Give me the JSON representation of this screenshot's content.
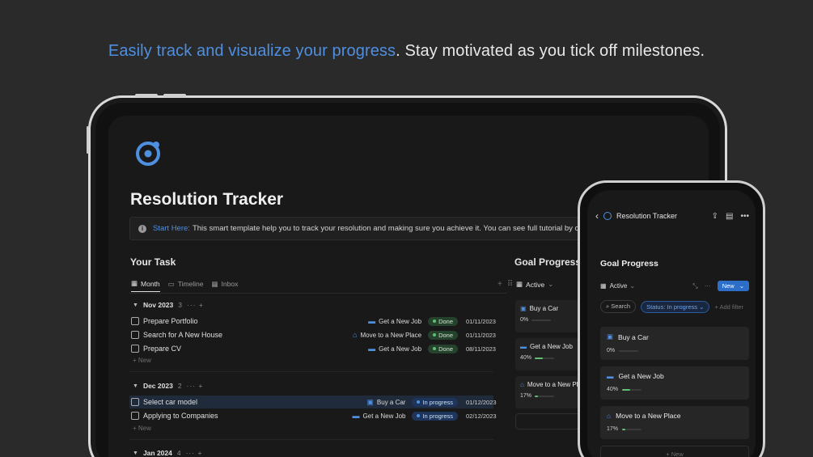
{
  "headline": {
    "accent": "Easily track and visualize your progress",
    "rest": ". Stay motivated as you tick off milestones."
  },
  "tablet": {
    "page_title": "Resolution Tracker",
    "callout": {
      "link": "Start Here:",
      "text": "This smart template help you to track your resolution and making sure you achieve it. You can see full tutorial by clicking here."
    },
    "your_task": {
      "title": "Your Task",
      "views": [
        "Month",
        "Timeline",
        "Inbox"
      ],
      "groups": [
        {
          "label": "Nov 2023",
          "count": "3",
          "tasks": [
            {
              "name": "Prepare Portfolio",
              "goal": "Get a New Job",
              "status": "Done",
              "date": "01/11/2023"
            },
            {
              "name": "Search for A New House",
              "goal": "Move to a New Place",
              "status": "Done",
              "date": "01/11/2023"
            },
            {
              "name": "Prepare CV",
              "goal": "Get a New Job",
              "status": "Done",
              "date": "08/11/2023"
            }
          ]
        },
        {
          "label": "Dec 2023",
          "count": "2",
          "tasks": [
            {
              "name": "Select car model",
              "goal": "Buy a Car",
              "status": "In progress",
              "date": "01/12/2023"
            },
            {
              "name": "Applying to Companies",
              "goal": "Get a New Job",
              "status": "In progress",
              "date": "02/12/2023"
            }
          ]
        },
        {
          "label": "Jan 2024",
          "count": "4",
          "tasks": []
        }
      ],
      "new_label": "New"
    },
    "goal_progress": {
      "title": "Goal Progress",
      "view": "Active",
      "cards": [
        {
          "name": "Buy a Car",
          "progress": "0%",
          "pct": 0
        },
        {
          "name": "Get a New Job",
          "progress": "40%",
          "pct": 40
        },
        {
          "name": "Move to a New Place",
          "progress": "17%",
          "pct": 17
        }
      ]
    }
  },
  "phone": {
    "header_title": "Resolution Tracker",
    "section_title": "Goal Progress",
    "view": "Active",
    "new_button": "New",
    "search": "Search",
    "filter_chip": "Status: In progress",
    "add_filter": "+ Add filter",
    "cards": [
      {
        "name": "Buy a Car",
        "progress": "0%",
        "pct": 0
      },
      {
        "name": "Get a New Job",
        "progress": "40%",
        "pct": 40
      },
      {
        "name": "Move to a New Place",
        "progress": "17%",
        "pct": 17
      }
    ],
    "new_row": "+ New"
  },
  "colors": {
    "accent": "#4f8fe0",
    "done": "#24422c",
    "in_progress": "#1d355a",
    "progress_bar": "#5fbf73"
  }
}
